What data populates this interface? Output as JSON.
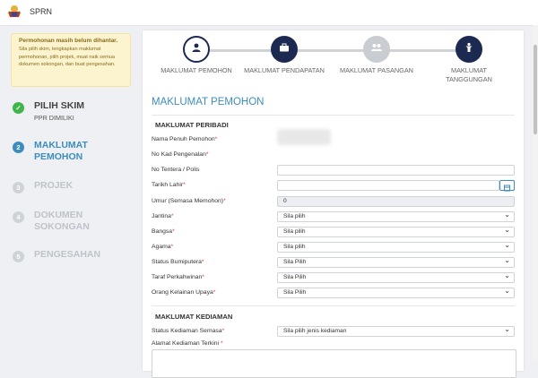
{
  "app": {
    "title": "SPRN",
    "logo_name": "coat-of-arms"
  },
  "notice": {
    "title": "Permohonan masih belum dihantar.",
    "body": "Sila pilih skim, lengkapkan maklumat permohonan, pilih projek, muat naik semua dokumen sokongan, dan buat pengesahan."
  },
  "left_steps": [
    {
      "num": "✓",
      "line1": "PILIH SKIM",
      "line1b": "",
      "line2": "PPR DIMILIKI",
      "state": "done"
    },
    {
      "num": "2",
      "line1": "MAKLUMAT",
      "line1b": "PEMOHON",
      "line2": "",
      "state": "active"
    },
    {
      "num": "3",
      "line1": "PROJEK",
      "line1b": "",
      "line2": "",
      "state": "inactive"
    },
    {
      "num": "4",
      "line1": "DOKUMEN",
      "line1b": "SOKONGAN",
      "line2": "",
      "state": "inactive"
    },
    {
      "num": "5",
      "line1": "PENGESAHAN",
      "line1b": "",
      "line2": "",
      "state": "inactive"
    }
  ],
  "wizard": [
    {
      "label": "MAKLUMAT PEMOHON",
      "label2": "",
      "icon": "user-icon",
      "state": "current"
    },
    {
      "label": "MAKLUMAT PENDAPATAN",
      "label2": "",
      "icon": "briefcase-icon",
      "state": "active"
    },
    {
      "label": "MAKLUMAT PASANGAN",
      "label2": "",
      "icon": "users-icon",
      "state": "disabled"
    },
    {
      "label": "MAKLUMAT",
      "label2": "TANGGUNGAN",
      "icon": "child-icon",
      "state": "active"
    }
  ],
  "form": {
    "section_title": "MAKLUMAT PEMOHON",
    "personal_title": "MAKLUMAT PERIBADI",
    "fields": {
      "nama": "Nama Penuh Pemohon",
      "ic": "No Kad Pengenalan",
      "tentera": "No Tentera / Polis",
      "tarikh": "Tarikh Lahir",
      "umur": "Umur (Semasa Memohon)",
      "umur_value": "0",
      "jantina": "Jantina",
      "jantina_value": "Sila pilih",
      "bangsa": "Bangsa",
      "bangsa_value": "Sila pilih",
      "agama": "Agama",
      "agama_value": "Sila pilih",
      "bumiputera": "Status Bumiputera",
      "bumiputera_value": "Sila Pilih",
      "taraf": "Taraf Perkahwinan",
      "taraf_value": "Sila Pilih",
      "oku": "Orang Kelainan Upaya",
      "oku_value": "Sila Pilih"
    },
    "residence_title": "MAKLUMAT KEDIAMAN",
    "status_kediaman": "Status Kediaman Semasa",
    "status_kediaman_value": "Sila pilih jenis kediaman",
    "alamat": "Alamat Kediaman Terkini"
  },
  "colors": {
    "primary": "#2f4a8a",
    "dark_navy": "#1c2a52",
    "green": "#3fb64a",
    "blue_step": "#3c8dbc",
    "gray": "#c9ccd1",
    "notice_bg": "#fcf3cf"
  }
}
